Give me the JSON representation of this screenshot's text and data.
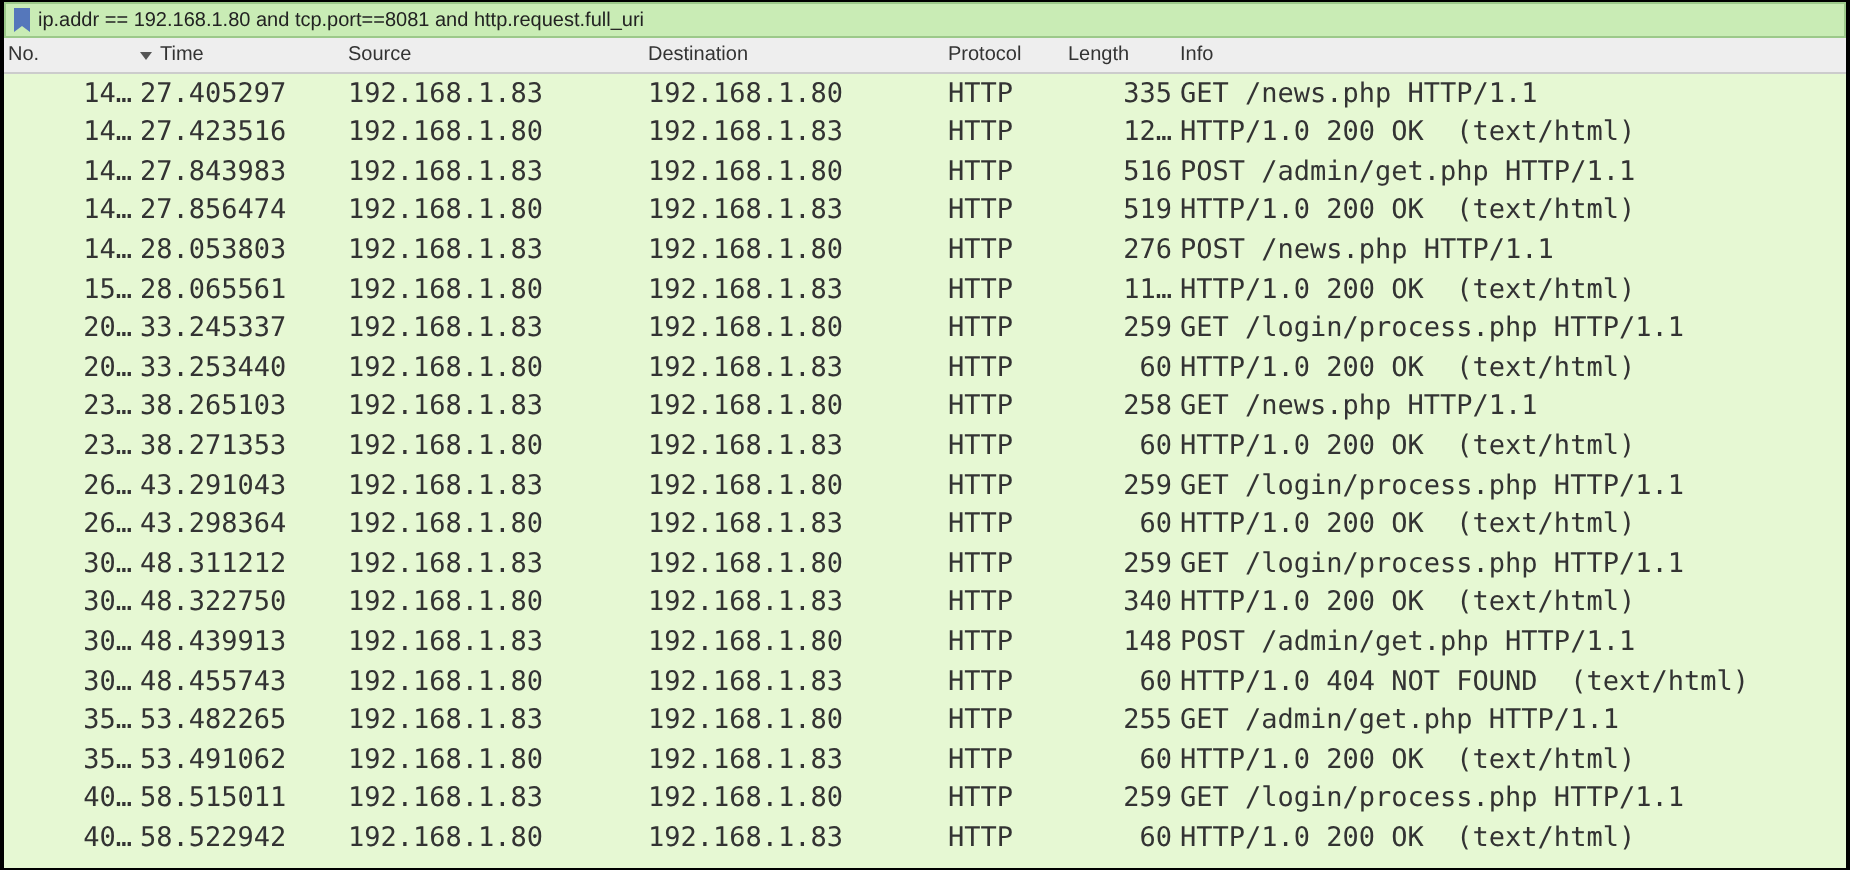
{
  "filter_bar": {
    "value": "ip.addr == 192.168.1.80 and tcp.port==8081 and http.request.full_uri"
  },
  "packet_list": {
    "columns": [
      {
        "label": "No.",
        "sorted": false
      },
      {
        "label": "Time",
        "sorted": true
      },
      {
        "label": "Source",
        "sorted": false
      },
      {
        "label": "Destination",
        "sorted": false
      },
      {
        "label": "Protocol",
        "sorted": false
      },
      {
        "label": "Length",
        "sorted": false
      },
      {
        "label": "Info",
        "sorted": false
      }
    ],
    "rows": [
      [
        "14…",
        "27.405297",
        "192.168.1.83",
        "192.168.1.80",
        "HTTP",
        "335",
        "GET /news.php HTTP/1.1"
      ],
      [
        "14…",
        "27.423516",
        "192.168.1.80",
        "192.168.1.83",
        "HTTP",
        "12…",
        "HTTP/1.0 200 OK  (text/html)"
      ],
      [
        "14…",
        "27.843983",
        "192.168.1.83",
        "192.168.1.80",
        "HTTP",
        "516",
        "POST /admin/get.php HTTP/1.1"
      ],
      [
        "14…",
        "27.856474",
        "192.168.1.80",
        "192.168.1.83",
        "HTTP",
        "519",
        "HTTP/1.0 200 OK  (text/html)"
      ],
      [
        "14…",
        "28.053803",
        "192.168.1.83",
        "192.168.1.80",
        "HTTP",
        "276",
        "POST /news.php HTTP/1.1"
      ],
      [
        "15…",
        "28.065561",
        "192.168.1.80",
        "192.168.1.83",
        "HTTP",
        "11…",
        "HTTP/1.0 200 OK  (text/html)"
      ],
      [
        "20…",
        "33.245337",
        "192.168.1.83",
        "192.168.1.80",
        "HTTP",
        "259",
        "GET /login/process.php HTTP/1.1"
      ],
      [
        "20…",
        "33.253440",
        "192.168.1.80",
        "192.168.1.83",
        "HTTP",
        "60",
        "HTTP/1.0 200 OK  (text/html)"
      ],
      [
        "23…",
        "38.265103",
        "192.168.1.83",
        "192.168.1.80",
        "HTTP",
        "258",
        "GET /news.php HTTP/1.1"
      ],
      [
        "23…",
        "38.271353",
        "192.168.1.80",
        "192.168.1.83",
        "HTTP",
        "60",
        "HTTP/1.0 200 OK  (text/html)"
      ],
      [
        "26…",
        "43.291043",
        "192.168.1.83",
        "192.168.1.80",
        "HTTP",
        "259",
        "GET /login/process.php HTTP/1.1"
      ],
      [
        "26…",
        "43.298364",
        "192.168.1.80",
        "192.168.1.83",
        "HTTP",
        "60",
        "HTTP/1.0 200 OK  (text/html)"
      ],
      [
        "30…",
        "48.311212",
        "192.168.1.83",
        "192.168.1.80",
        "HTTP",
        "259",
        "GET /login/process.php HTTP/1.1"
      ],
      [
        "30…",
        "48.322750",
        "192.168.1.80",
        "192.168.1.83",
        "HTTP",
        "340",
        "HTTP/1.0 200 OK  (text/html)"
      ],
      [
        "30…",
        "48.439913",
        "192.168.1.83",
        "192.168.1.80",
        "HTTP",
        "148",
        "POST /admin/get.php HTTP/1.1"
      ],
      [
        "30…",
        "48.455743",
        "192.168.1.80",
        "192.168.1.83",
        "HTTP",
        "60",
        "HTTP/1.0 404 NOT FOUND  (text/html)"
      ],
      [
        "35…",
        "53.482265",
        "192.168.1.83",
        "192.168.1.80",
        "HTTP",
        "255",
        "GET /admin/get.php HTTP/1.1"
      ],
      [
        "35…",
        "53.491062",
        "192.168.1.80",
        "192.168.1.83",
        "HTTP",
        "60",
        "HTTP/1.0 200 OK  (text/html)"
      ],
      [
        "40…",
        "58.515011",
        "192.168.1.83",
        "192.168.1.80",
        "HTTP",
        "259",
        "GET /login/process.php HTTP/1.1"
      ],
      [
        "40…",
        "58.522942",
        "192.168.1.80",
        "192.168.1.83",
        "HTTP",
        "60",
        "HTTP/1.0 200 OK  (text/html)"
      ]
    ]
  }
}
